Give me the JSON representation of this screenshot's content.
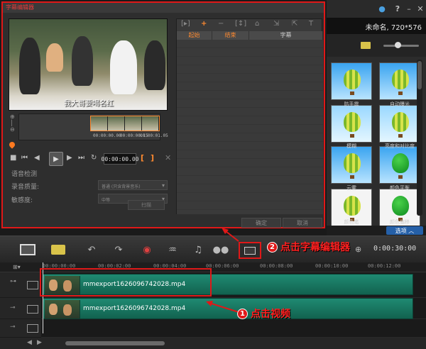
{
  "project": {
    "name": "未命名, 720*576"
  },
  "library": {
    "options_label": "选项",
    "items": [
      {
        "label": "防手震"
      },
      {
        "label": "自动曝光"
      },
      {
        "label": "模糊"
      },
      {
        "label": "亮度和对比度"
      },
      {
        "label": "云雾"
      },
      {
        "label": "颜色平衡"
      },
      {
        "label": "颜色笔"
      },
      {
        "label": "颜色偏移"
      }
    ]
  },
  "subtitle_editor": {
    "title": "字幕编辑器",
    "preview_subtitle": "我大哥要喝名红",
    "filmstrip_timecodes": [
      "00:00:00.00",
      "00:00:00.15",
      "00:00:01.05"
    ],
    "timecode": "00:00:00.00",
    "voice_detection": {
      "heading": "语音检测",
      "quality_label": "录音质量:",
      "quality_value": "普通 (只含背景音乐)",
      "sensitivity_label": "敏感度:",
      "sensitivity_value": "中等"
    },
    "scan_label": "扫描",
    "columns": {
      "start": "起始",
      "end": "结束",
      "subtitle": "字幕"
    },
    "ok_label": "确定",
    "cancel_label": "取消"
  },
  "timeline": {
    "timecode": "0:00:30:00",
    "ruler": [
      "00:00:00:00",
      "00:00:02:00",
      "00:00:04:00",
      "00:00:06:00",
      "00:00:08:00",
      "00:00:10:00",
      "00:00:12:00"
    ],
    "clips": [
      {
        "name": "mmexport1626096742028.mp4"
      },
      {
        "name": "mmexport1626096742028.mp4"
      }
    ]
  },
  "annotations": {
    "step1": {
      "number": "1",
      "text": "点击视频"
    },
    "step2": {
      "number": "2",
      "text": "点击字幕编辑器"
    }
  },
  "colors": {
    "accent": "#ff8a30",
    "annotation": "#e01818",
    "clip": "#1f8a72",
    "options": "#2560a8"
  }
}
